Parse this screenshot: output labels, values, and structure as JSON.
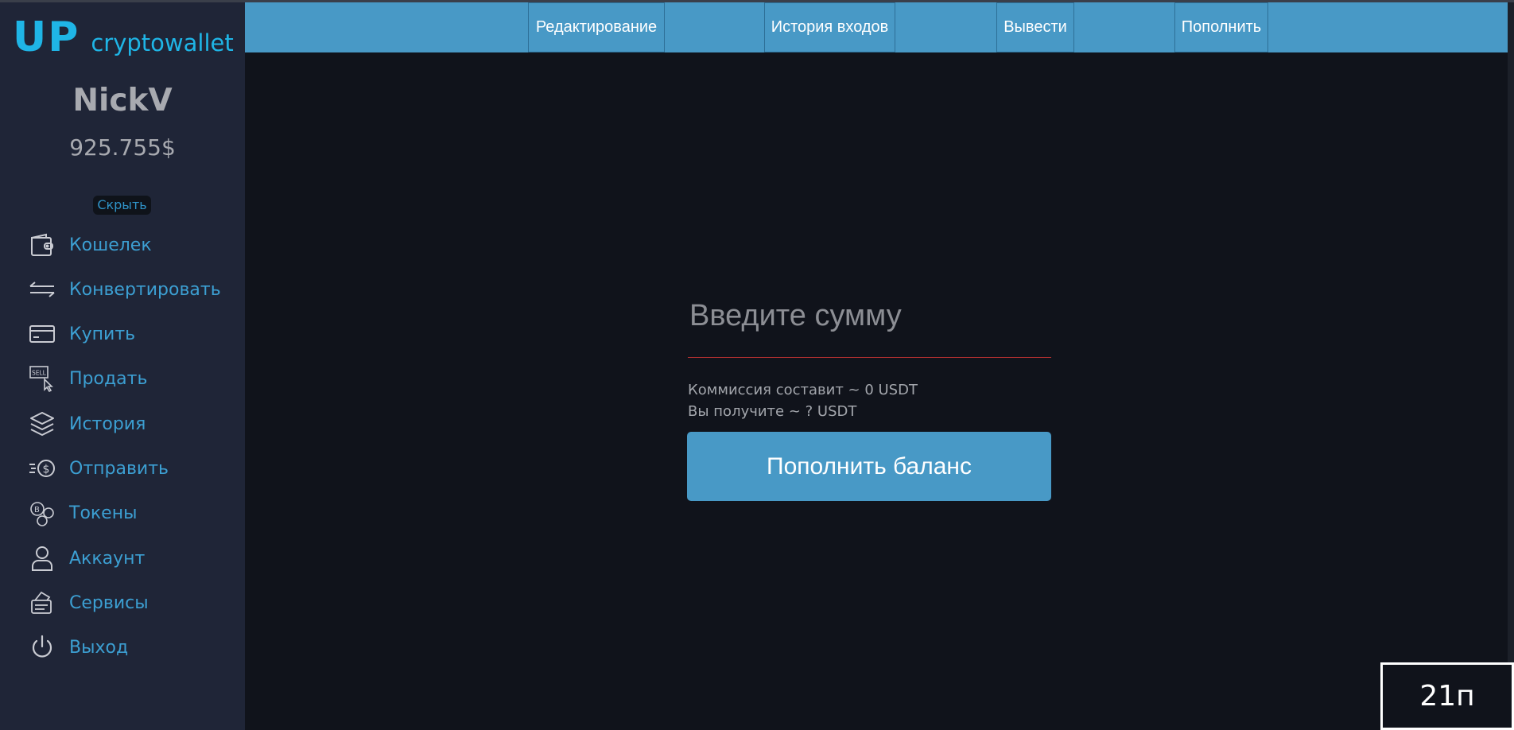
{
  "logo": {
    "main": "UP",
    "sub": "cryptowallet"
  },
  "user": {
    "name": "NickV",
    "balance": "925.755$",
    "hide_label": "Скрыть"
  },
  "sidebar": {
    "items": [
      {
        "label": "Кошелек",
        "icon": "wallet-icon"
      },
      {
        "label": "Конвертировать",
        "icon": "convert-arrows-icon"
      },
      {
        "label": "Купить",
        "icon": "credit-card-icon"
      },
      {
        "label": "Продать",
        "icon": "sell-sign-icon"
      },
      {
        "label": "История",
        "icon": "layers-icon"
      },
      {
        "label": "Отправить",
        "icon": "send-dollar-icon"
      },
      {
        "label": "Токены",
        "icon": "tokens-icon"
      },
      {
        "label": "Аккаунт",
        "icon": "user-icon"
      },
      {
        "label": "Сервисы",
        "icon": "services-icon"
      },
      {
        "label": "Выход",
        "icon": "power-icon"
      }
    ]
  },
  "topnav": {
    "items": [
      {
        "label": "Редактирование"
      },
      {
        "label": "История входов"
      },
      {
        "label": "Вывести"
      },
      {
        "label": "Пополнить"
      }
    ]
  },
  "form": {
    "amount_placeholder": "Введите сумму",
    "amount_value": "",
    "commission": "Коммиссия составит ~ 0 USDT",
    "receive": "Вы получите ~ ? USDT",
    "submit_label": "Пополнить баланс"
  },
  "corner_label": "21п",
  "colors": {
    "accent": "#4899c6",
    "link": "#3c9fd2",
    "logo": "#1fb5e6",
    "sidebar_bg": "#1f2537",
    "page_bg": "#10131b",
    "input_underline": "#b23030"
  }
}
